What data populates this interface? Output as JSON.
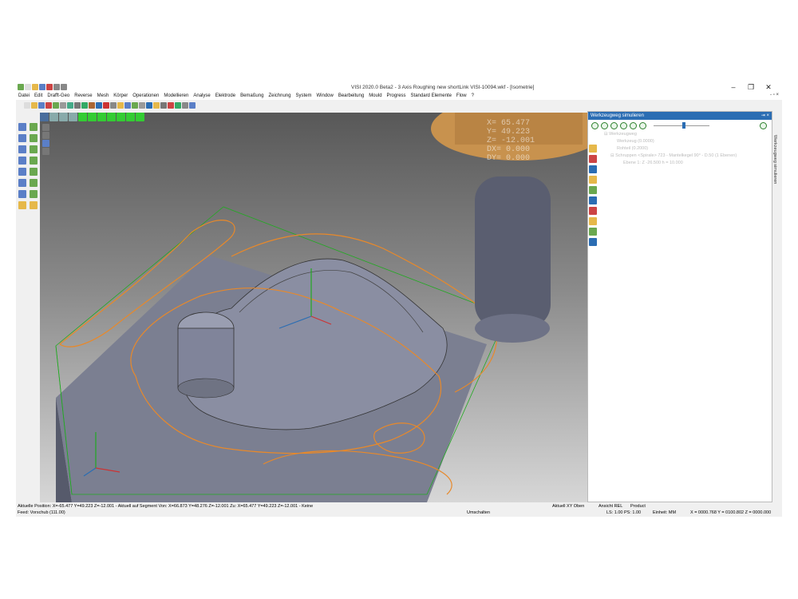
{
  "window": {
    "title": "VISI 2020.0 Beta2 - 3 Axis Roughing new shortLink VISI-10094.wkf - [Isometrie]",
    "controls": [
      "–",
      "❐",
      "✕"
    ]
  },
  "menu": {
    "items": [
      "Datei",
      "Edit",
      "Drafft-Geo",
      "Reverse",
      "Mesh",
      "Körper",
      "Operationen",
      "Modellieren",
      "Analyse",
      "Elektrode",
      "Bemaßung",
      "Zeichnung",
      "System",
      "Window",
      "Bearbeitung",
      "Mould",
      "Progress",
      "Standard Elemente",
      "Flow",
      "?"
    ],
    "right": "- ▫ ×"
  },
  "viewport": {
    "coords": [
      "X=  65.477",
      "Y=  49.223",
      "Z= -12.001",
      "DX=  0.000",
      "DY=  0.000"
    ]
  },
  "panel": {
    "title": "Werkzeugweg simulieren",
    "pin": "⇥ ×",
    "tree": [
      "⊟ Werkzeugweg",
      "Werkzeug (0.0000)",
      "Rohteil (0.2000)",
      "⊟ Schruppen <Spirale> 723 - Mantelkegel 90° - D.50 (1 Ebenen)",
      "Ebene 1: Z -26.500 h = 10.000"
    ],
    "slider_fraction": 0.55
  },
  "right_rail": {
    "label": "Werkzeugweg simulieren"
  },
  "status": {
    "position": "Aktuelle Position: X=-65.477 Y=49.223 Z=-12.001 - Aktuell auf Segment Von: X=66.873 Y=48.276 Z=-12.001 Zu: X=65.477 Y=49.223 Z=-12.001 - Keine",
    "view_label": "Aktuell XY Oben",
    "ansicht": "Ansicht REL",
    "product": "Product",
    "feed": "Feed: Vorschub (111.00)",
    "umschalten": "Umschalten",
    "ls": "LS: 1.00 PS: 1.00",
    "einheit": "Einheit: MM",
    "xyz": "X = 0000.768 Y = 0100.802 Z = 0000.000"
  },
  "colors": {
    "toolpath": "#e8892a",
    "stock": "#22aa22",
    "part": "#6f7383",
    "tool": "#c8924e",
    "panel_head": "#2b6db3"
  }
}
